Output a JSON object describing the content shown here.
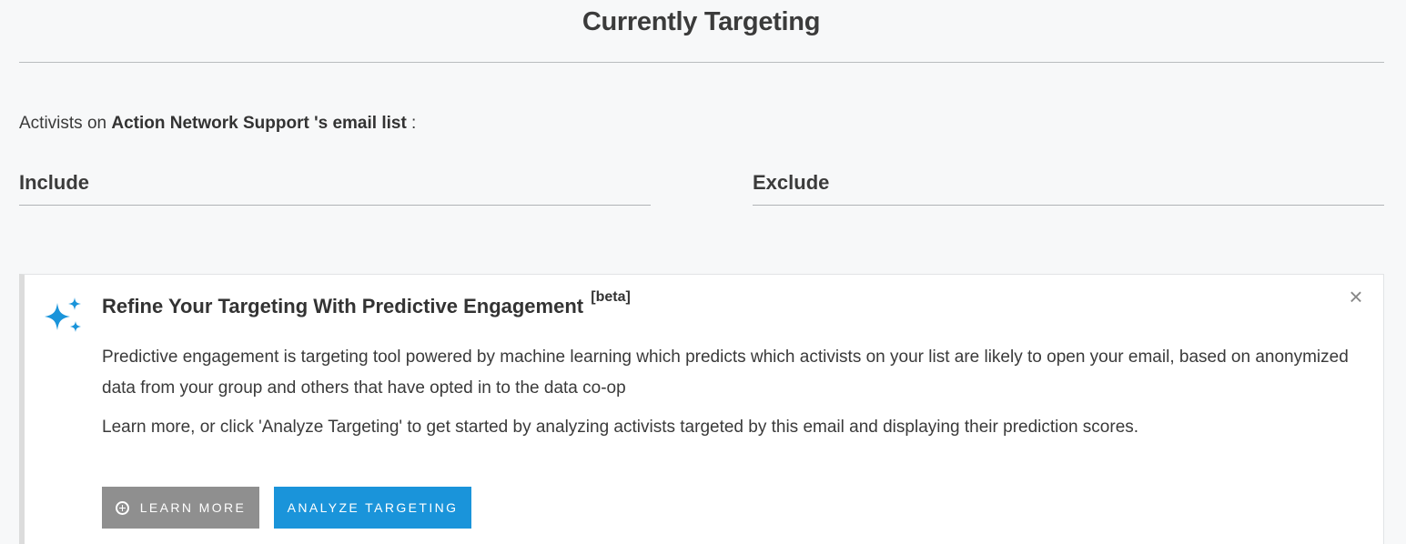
{
  "header": {
    "title": "Currently Targeting"
  },
  "audience": {
    "prefix": "Activists on ",
    "list_name": "Action Network Support 's email list",
    "suffix": " :"
  },
  "columns": {
    "include_label": "Include",
    "exclude_label": "Exclude"
  },
  "callout": {
    "icon": "sparkle-icon",
    "title": "Refine Your Targeting With Predictive Engagement",
    "badge": "[beta]",
    "close_symbol": "×",
    "body": "Predictive engagement is targeting tool powered by machine learning which predicts which activists on your list are likely to open your email, based on anonymized data from your group and others that have opted in to the data co-op",
    "body2": "Learn more, or click 'Analyze Targeting' to get started by analyzing activists targeted by this email and displaying their prediction scores.",
    "learn_more_label": "Learn More",
    "analyze_label": "Analyze Targeting"
  },
  "colors": {
    "background": "#f7f8f9",
    "accent": "#1a94da",
    "sparkle": "#1a94da",
    "secondary_button": "#8f8f8f"
  }
}
